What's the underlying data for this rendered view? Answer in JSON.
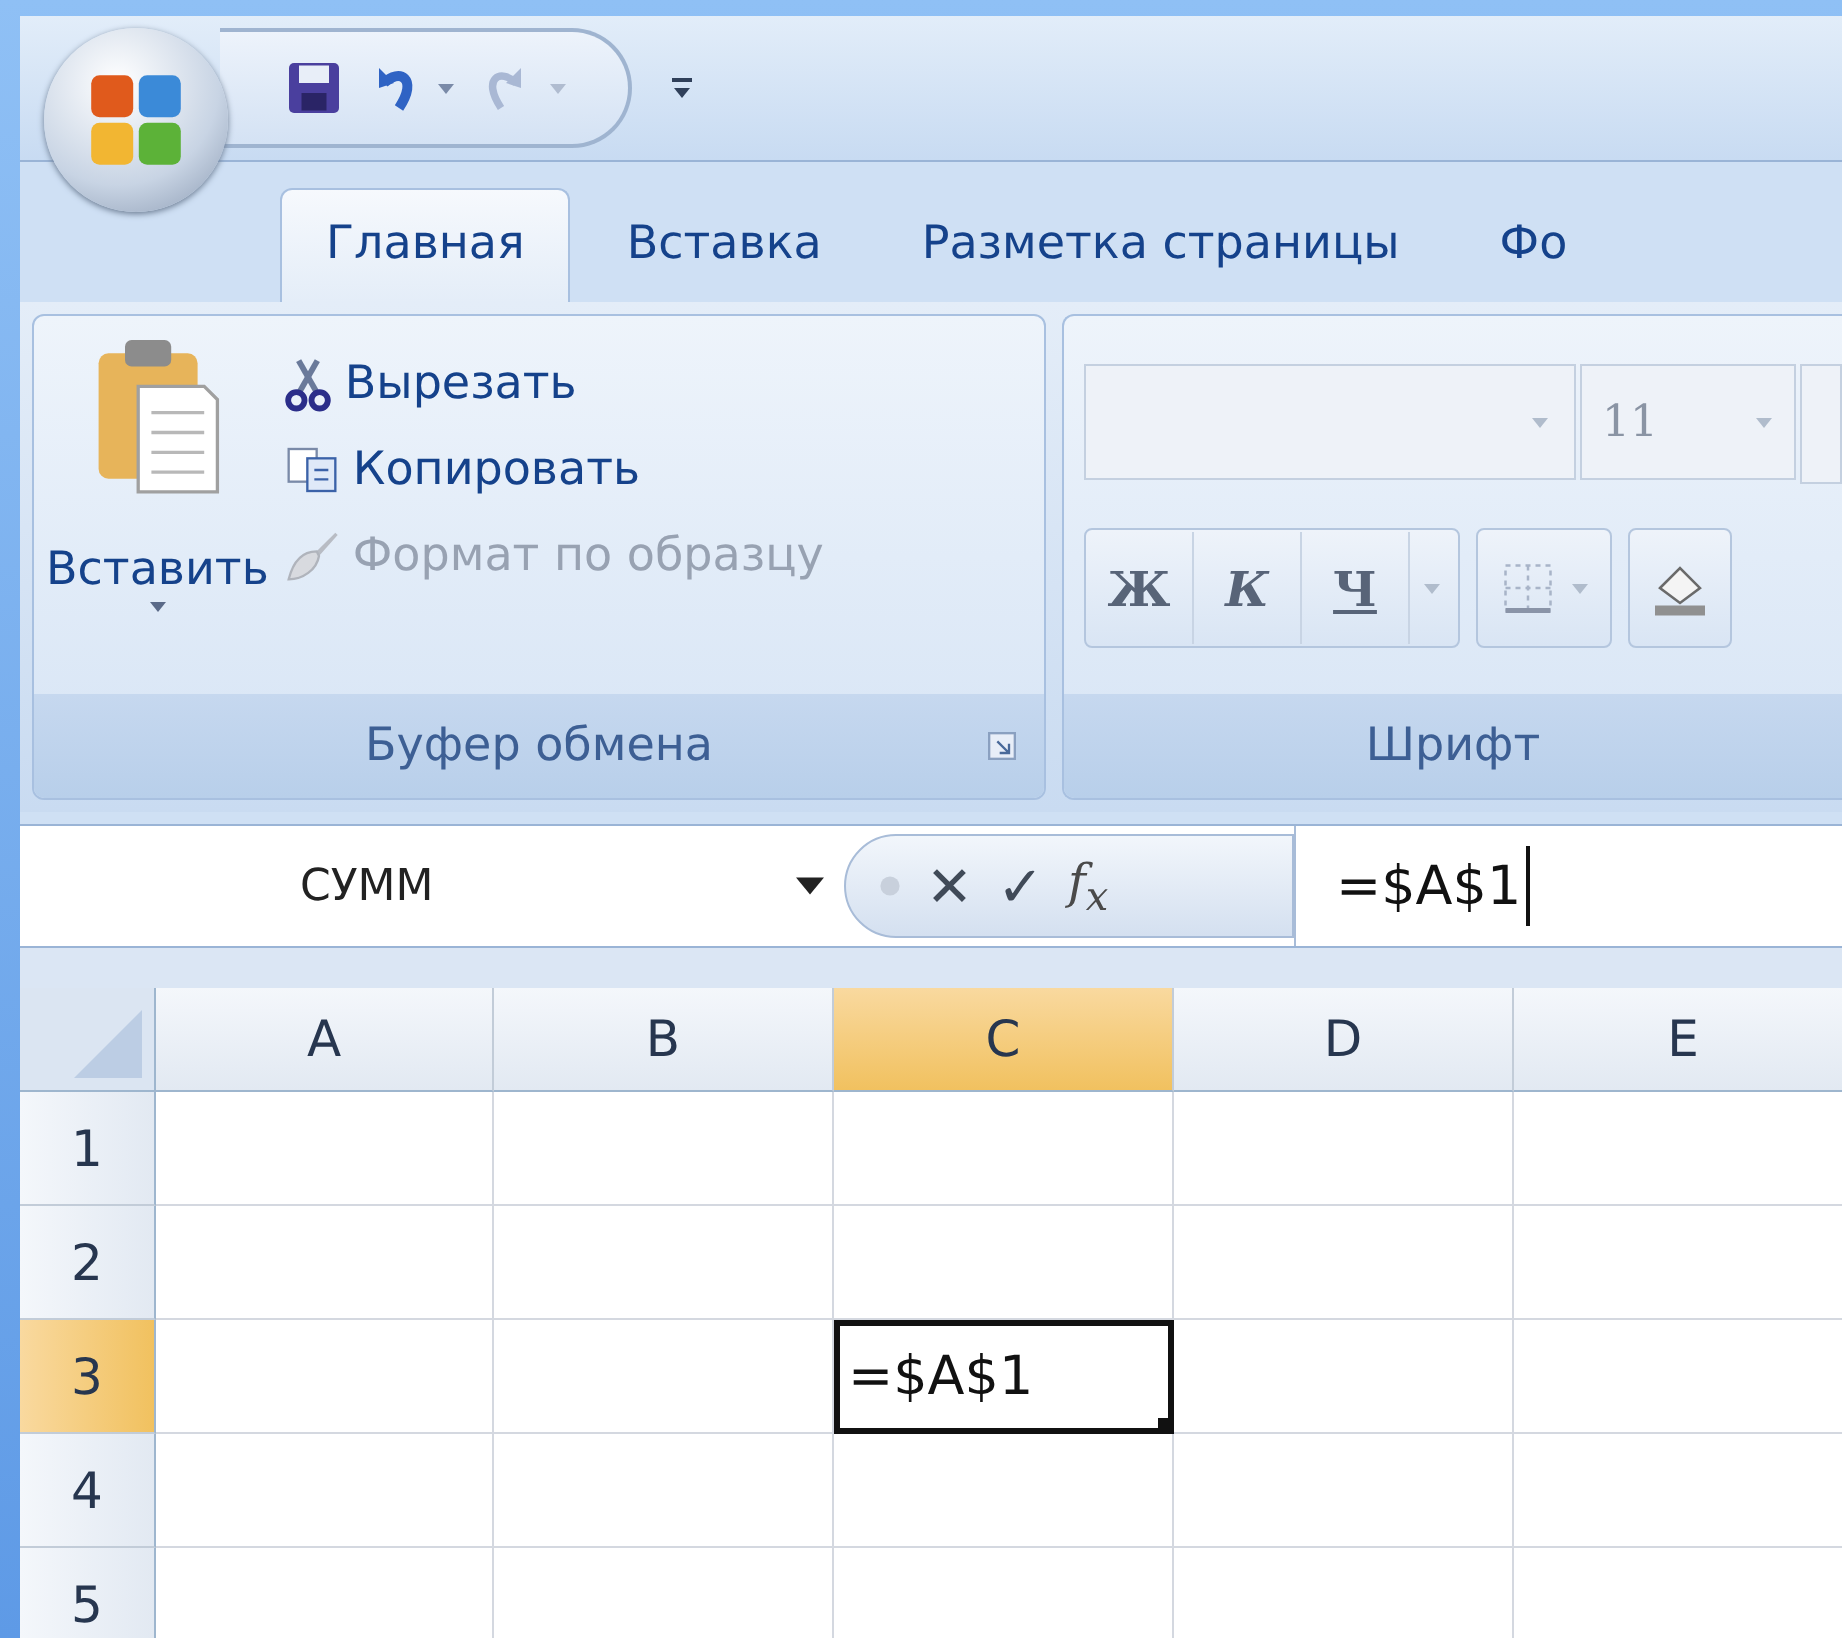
{
  "tabs": [
    {
      "label": "Главная",
      "selected": true
    },
    {
      "label": "Вставка",
      "selected": false
    },
    {
      "label": "Разметка страницы",
      "selected": false
    },
    {
      "label": "Фо",
      "selected": false
    }
  ],
  "clipboard_group": {
    "paste_label": "Вставить",
    "commands": [
      {
        "label": "Вырезать",
        "disabled": false
      },
      {
        "label": "Копировать",
        "disabled": false
      },
      {
        "label": "Формат по образцу",
        "disabled": true
      }
    ],
    "label": "Буфер обмена"
  },
  "font_group": {
    "font_size": "11",
    "format_buttons": [
      {
        "kind": "bold",
        "label": "Ж"
      },
      {
        "kind": "italic",
        "label": "К"
      },
      {
        "kind": "underline",
        "label": "Ч"
      }
    ],
    "label": "Шрифт"
  },
  "formula_bar": {
    "name_box": "СУММ",
    "cancel": "✕",
    "enter": "✓",
    "function": "f$_{x}$",
    "formula": "=$A$1"
  },
  "columns": [
    {
      "label": "A",
      "selected": false
    },
    {
      "label": "B",
      "selected": false
    },
    {
      "label": "C",
      "selected": true
    },
    {
      "label": "D",
      "selected": false
    },
    {
      "label": "E",
      "selected": false
    }
  ],
  "rows": [
    {
      "label": "1",
      "selected": false
    },
    {
      "label": "2",
      "selected": false
    },
    {
      "label": "3",
      "selected": true
    },
    {
      "label": "4",
      "selected": false
    },
    {
      "label": "5",
      "selected": false
    }
  ],
  "active_cell": {
    "value": "=$A$1"
  }
}
